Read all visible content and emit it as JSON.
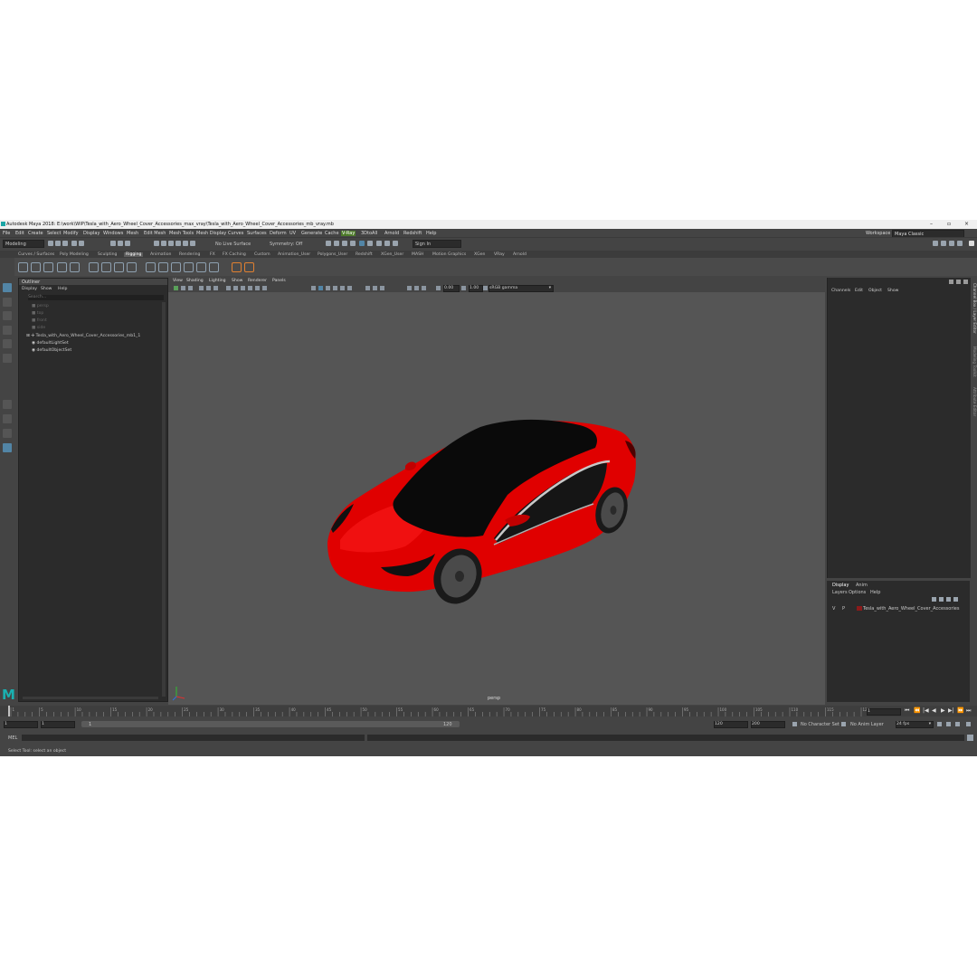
{
  "app": {
    "title": "Autodesk Maya 2018: E:\\work\\WIP\\Tesla_with_Aero_Wheel_Cover_Accessories_max_vray\\Tesla_with_Aero_Wheel_Cover_Accessories_mb_vray.mb",
    "logo": "M"
  },
  "menubar": [
    "File",
    "Edit",
    "Create",
    "Select",
    "Modify",
    "Display",
    "Windows",
    "Mesh",
    "Edit Mesh",
    "Mesh Tools",
    "Mesh Display",
    "Curves",
    "Surfaces",
    "Deform",
    "UV",
    "Generate",
    "Cache",
    "V-Ray",
    "3DtoAll",
    "Arnold",
    "Redshift",
    "Help"
  ],
  "workspace": {
    "label": "Workspace :",
    "value": "Maya Classic"
  },
  "status": {
    "mode": "Modeling",
    "live_surface": "No Live Surface",
    "symmetry": "Symmetry: Off",
    "sign_in": "Sign In"
  },
  "shelf_tabs": [
    "Curves / Surfaces",
    "Poly Modeling",
    "Sculpting",
    "Rigging",
    "Animation",
    "Rendering",
    "FX",
    "FX Caching",
    "Custom",
    "Animation_User",
    "Polygons_User",
    "Redshift",
    "XGen_User",
    "MASH",
    "Motion Graphics",
    "XGen",
    "VRay",
    "Arnold"
  ],
  "shelf_active": "Rigging",
  "outliner": {
    "title": "Outliner",
    "menu": [
      "Display",
      "Show",
      "Help"
    ],
    "search_placeholder": "Search...",
    "items": [
      {
        "label": "persp",
        "dim": true
      },
      {
        "label": "top",
        "dim": true
      },
      {
        "label": "front",
        "dim": true
      },
      {
        "label": "side",
        "dim": true
      },
      {
        "label": "Tesla_with_Aero_Wheel_Cover_Accessories_mb1_1",
        "dim": false
      },
      {
        "label": "defaultLightSet",
        "dim": false
      },
      {
        "label": "defaultObjectSet",
        "dim": false
      }
    ]
  },
  "viewport": {
    "menu": [
      "View",
      "Shading",
      "Lighting",
      "Show",
      "Renderer",
      "Panels"
    ],
    "exposure": "0.00",
    "gamma": "1.00",
    "color_space": "sRGB gamma",
    "camera_label": "persp"
  },
  "channel_box": {
    "menu": [
      "Channels",
      "Edit",
      "Object",
      "Show"
    ],
    "side_tabs": [
      "Channel Box / Layer Editor",
      "Modeling Toolkit",
      "Attribute Editor"
    ]
  },
  "layer_editor": {
    "tabs": [
      "Display",
      "Anim"
    ],
    "menu": [
      "Layers",
      "Options",
      "Help"
    ],
    "layer": {
      "visible": "V",
      "playback": "P",
      "name": "Tesla_with_Aero_Wheel_Cover_Accessories",
      "color": "#8b1a1a"
    }
  },
  "timeline": {
    "ticks": [
      "1",
      "5",
      "10",
      "15",
      "20",
      "25",
      "30",
      "35",
      "40",
      "45",
      "50",
      "55",
      "60",
      "65",
      "70",
      "75",
      "80",
      "85",
      "90",
      "95",
      "100",
      "105",
      "110",
      "115",
      "120"
    ],
    "current_frame": "1"
  },
  "range": {
    "start": "1",
    "anim_start": "1",
    "slider_start": "1",
    "slider_end": "120",
    "end": "120",
    "anim_end": "200",
    "character_set": "No Character Set",
    "anim_layer": "No Anim Layer",
    "fps": "24 fps"
  },
  "command_line": {
    "lang": "MEL"
  },
  "help_line": "Select Tool: select an object",
  "colors": {
    "car_body": "#e00000",
    "car_glass": "#0a0a0a",
    "accent": "#5285a6"
  }
}
